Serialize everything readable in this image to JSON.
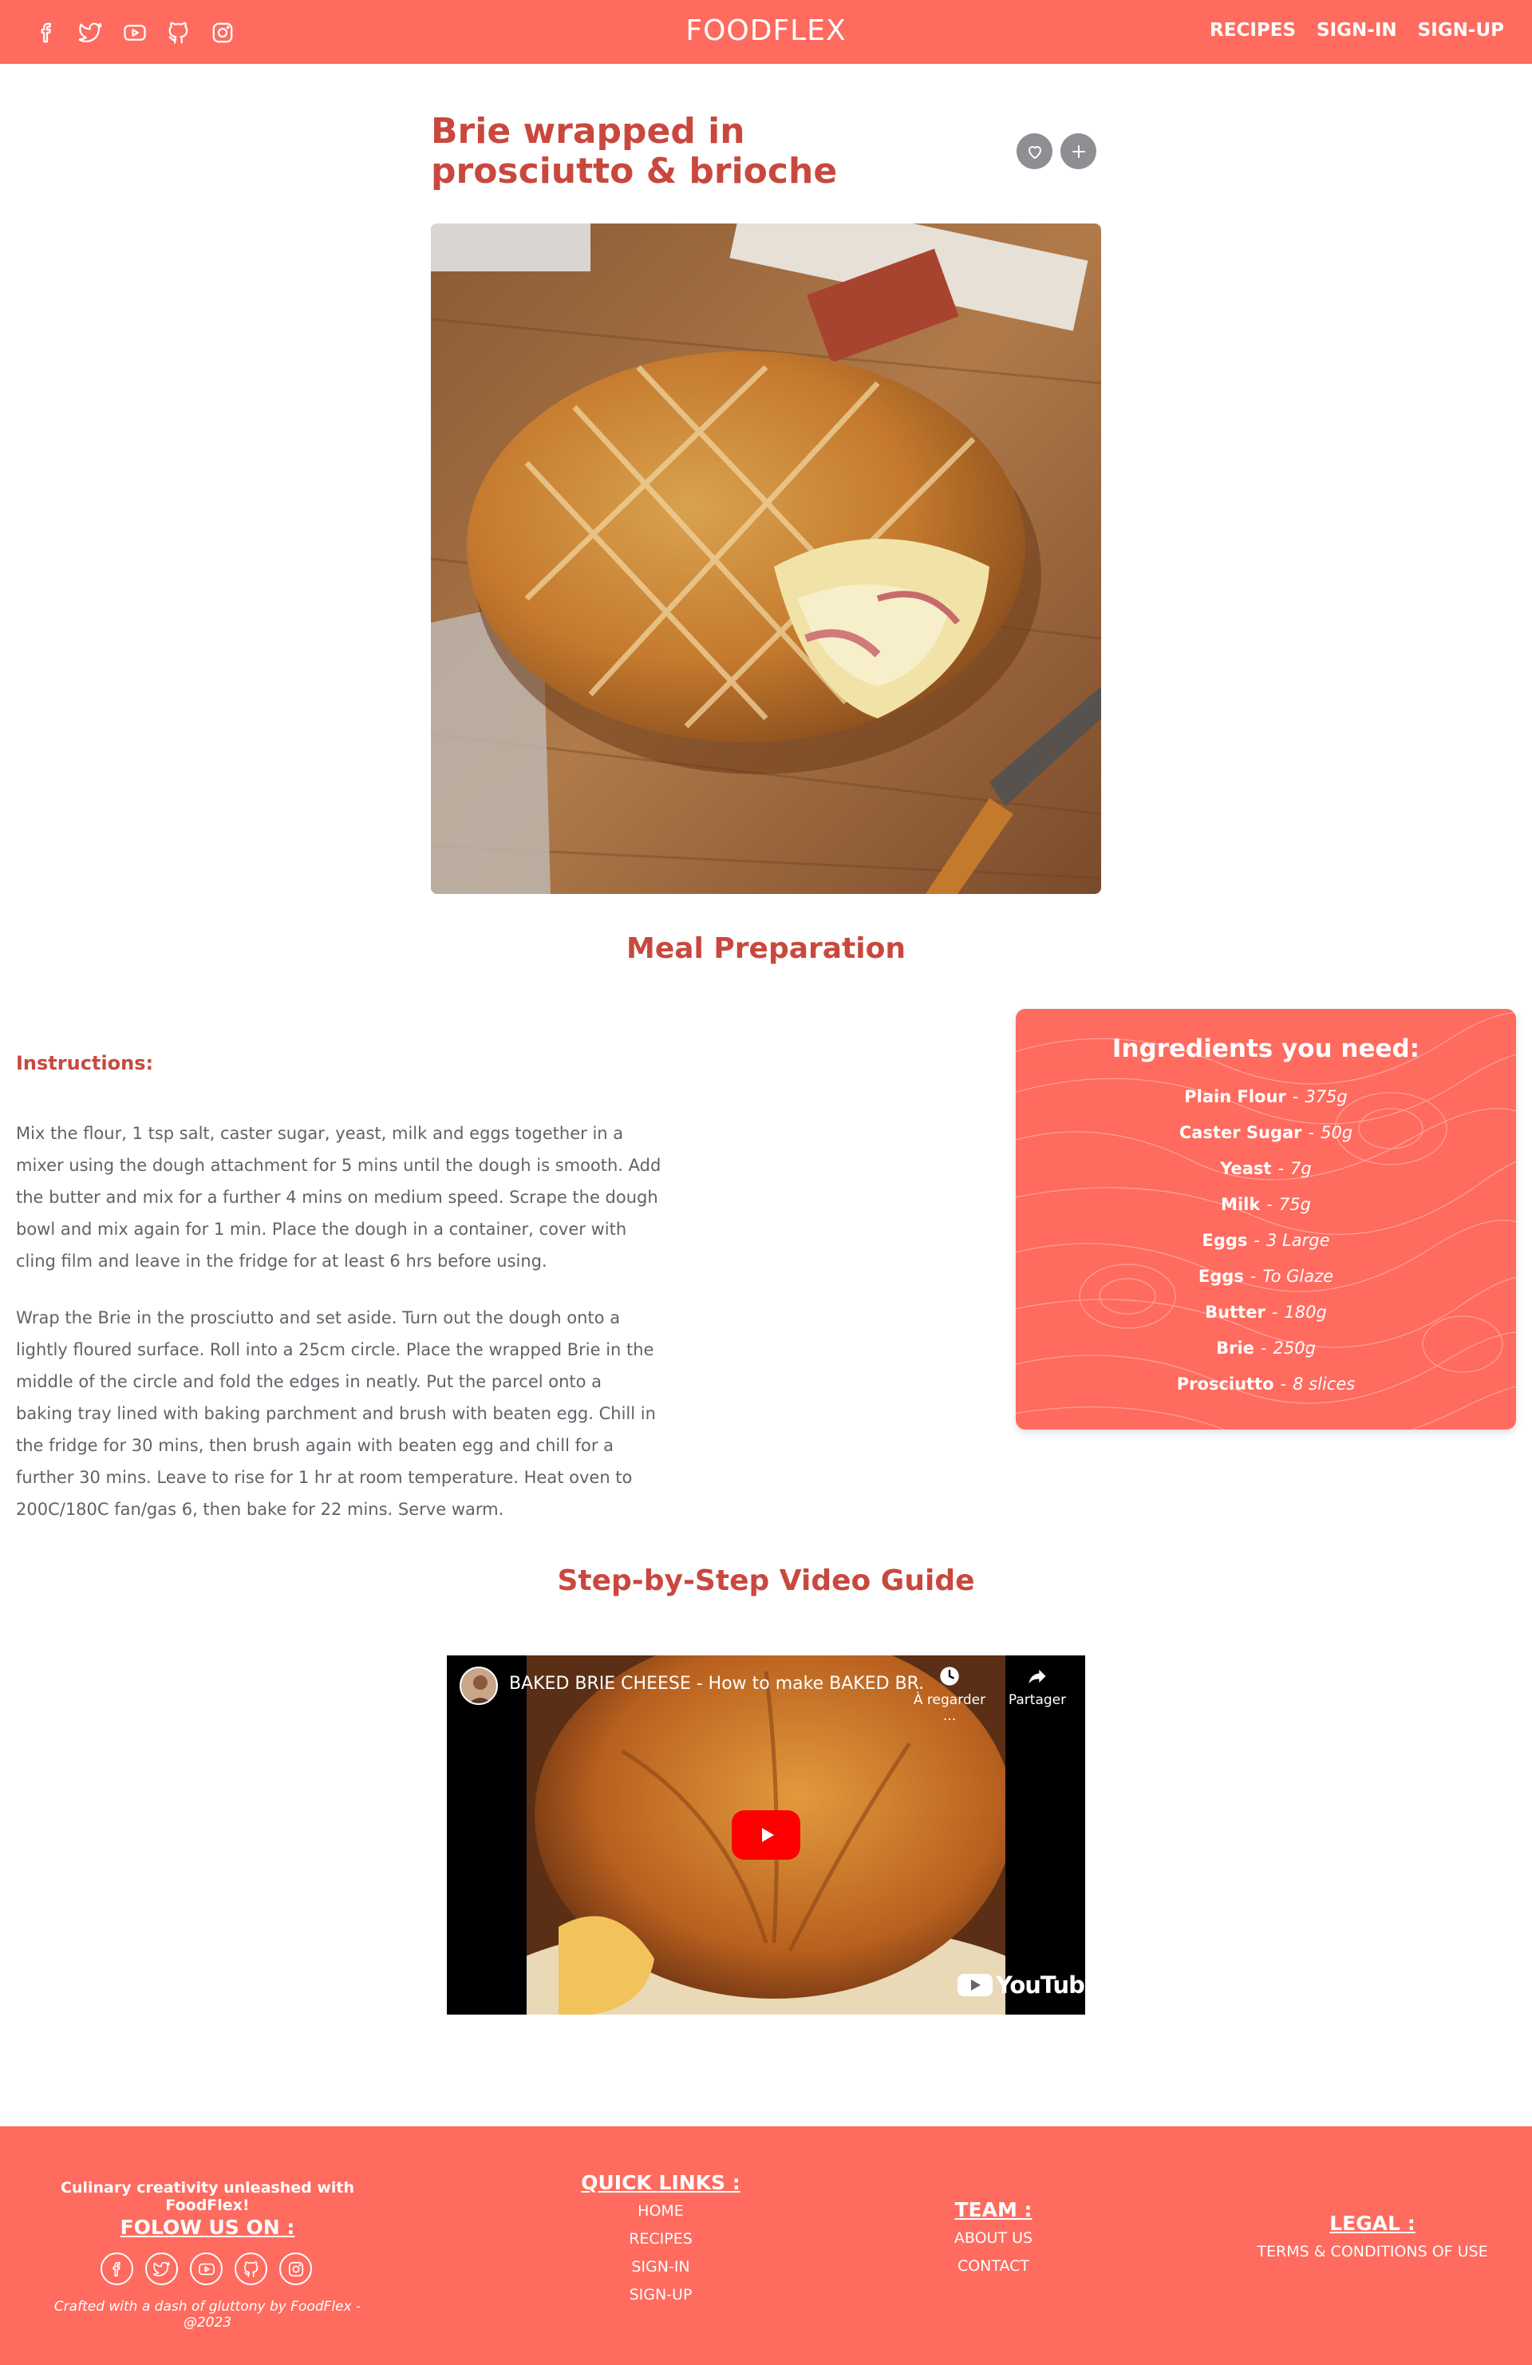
{
  "header": {
    "brand": "FOODFLEX",
    "social_icons": [
      "facebook-icon",
      "twitter-icon",
      "youtube-icon",
      "github-icon",
      "instagram-icon"
    ],
    "nav": [
      "RECIPES",
      "SIGN-IN",
      "SIGN-UP"
    ]
  },
  "recipe": {
    "title": "Brie wrapped in prosciutto & brioche",
    "actions": [
      "heart-icon",
      "plus-icon"
    ]
  },
  "preparation": {
    "heading": "Meal Preparation",
    "instructions_label": "Instructions:",
    "paragraphs": [
      "Mix the flour, 1 tsp salt, caster sugar, yeast, milk and eggs together in a mixer using the dough attachment for 5 mins until the dough is smooth. Add the butter and mix for a further 4 mins on medium speed. Scrape the dough bowl and mix again for 1 min. Place the dough in a container, cover with cling film and leave in the fridge for at least 6 hrs before using.",
      "Wrap the Brie in the prosciutto and set aside. Turn out the dough onto a lightly floured surface. Roll into a 25cm circle. Place the wrapped Brie in the middle of the circle and fold the edges in neatly. Put the parcel onto a baking tray lined with baking parchment and brush with beaten egg. Chill in the fridge for 30 mins, then brush again with beaten egg and chill for a further 30 mins. Leave to rise for 1 hr at room temperature. Heat oven to 200C/180C fan/gas 6, then bake for 22 mins. Serve warm."
    ]
  },
  "ingredients": {
    "title": "Ingredients you need:",
    "separator": "-",
    "items": [
      {
        "name": "Plain Flour",
        "qty": "375g"
      },
      {
        "name": "Caster Sugar",
        "qty": "50g"
      },
      {
        "name": "Yeast",
        "qty": "7g"
      },
      {
        "name": "Milk",
        "qty": "75g"
      },
      {
        "name": "Eggs",
        "qty": "3 Large"
      },
      {
        "name": "Eggs",
        "qty": "To Glaze"
      },
      {
        "name": "Butter",
        "qty": "180g"
      },
      {
        "name": "Brie",
        "qty": "250g"
      },
      {
        "name": "Prosciutto",
        "qty": "8 slices"
      }
    ]
  },
  "video": {
    "heading": "Step-by-Step Video Guide",
    "title": "BAKED BRIE CHEESE - How to make BAKED BR...",
    "watch_later": "À regarder ...",
    "share": "Partager",
    "logo": "YouTube"
  },
  "footer": {
    "tagline": "Culinary creativity unleashed with FoodFlex!",
    "follow": "FOLOW US ON :",
    "social_icons": [
      "facebook-icon",
      "twitter-icon",
      "youtube-icon",
      "github-icon",
      "instagram-icon"
    ],
    "credit": "Crafted with a dash of gluttony by FoodFlex - @2023",
    "quick_links": {
      "heading": "QUICK LINKS :",
      "links": [
        "HOME",
        "RECIPES",
        "SIGN-IN",
        "SIGN-UP"
      ]
    },
    "team": {
      "heading": "TEAM :",
      "links": [
        "ABOUT US",
        "CONTACT"
      ]
    },
    "legal": {
      "heading": "LEGAL :",
      "links": [
        "TERMS & CONDITIONS OF USE"
      ]
    }
  },
  "colors": {
    "brand": "#ff6b5f",
    "heading": "#c9483e",
    "body_text": "#5f6368",
    "button_gray": "#8f8f93"
  }
}
